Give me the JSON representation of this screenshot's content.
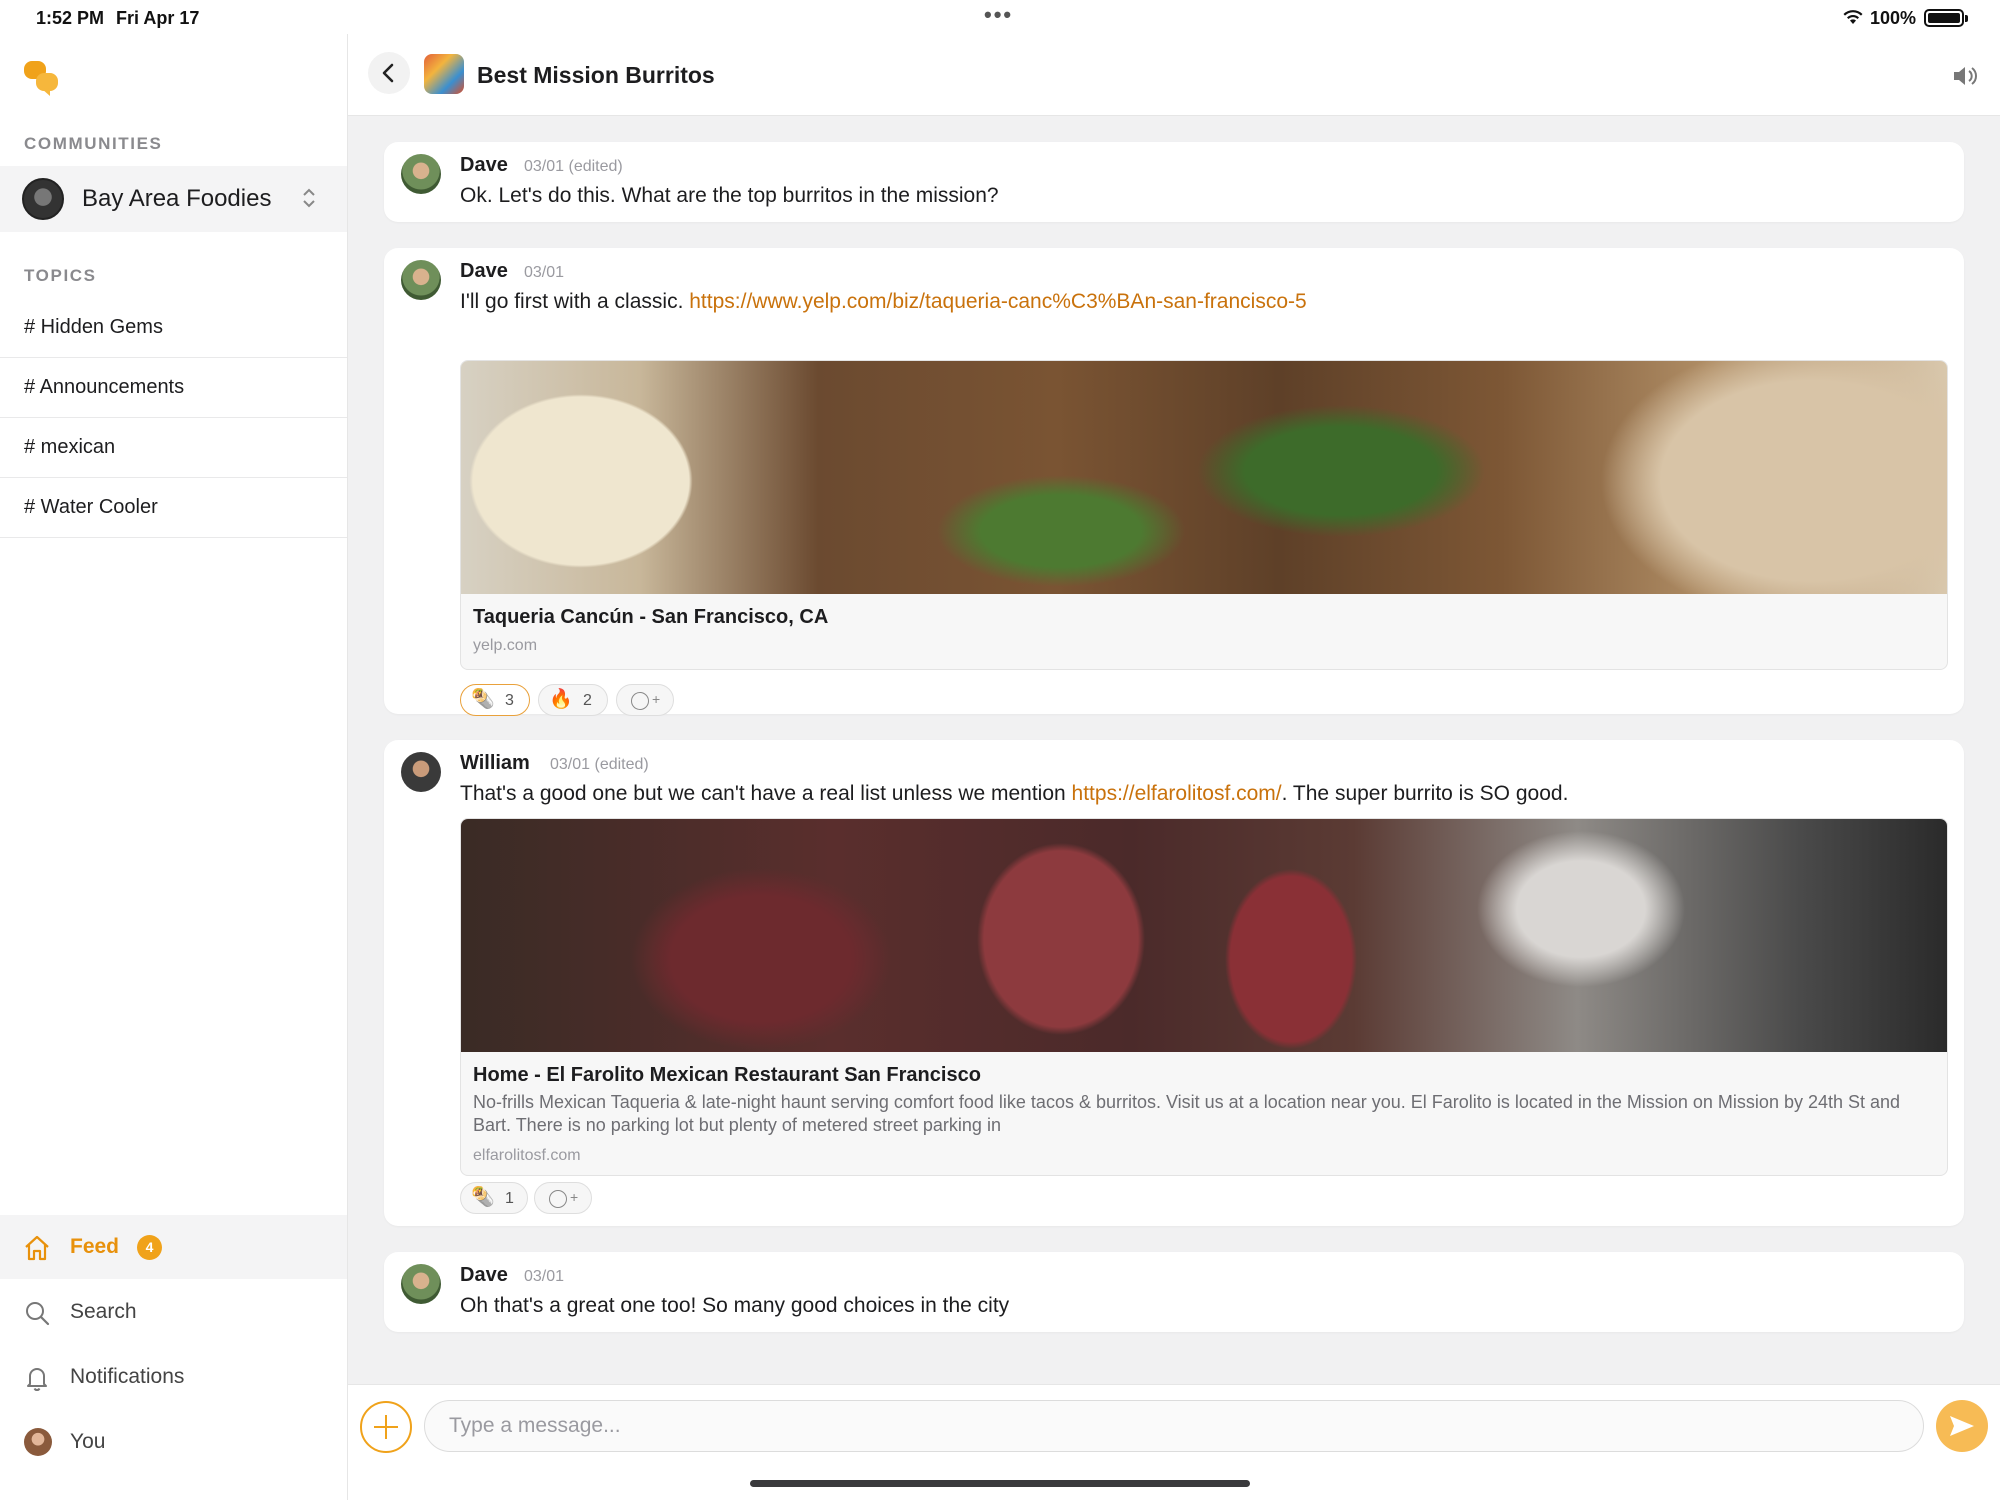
{
  "status_bar": {
    "time": "1:52 PM",
    "date": "Fri Apr 17",
    "battery": "100%"
  },
  "sidebar": {
    "communities_label": "COMMUNITIES",
    "community_name": "Bay Area Foodies",
    "topics_label": "TOPICS",
    "topics": [
      "# Hidden Gems",
      "# Announcements",
      "# mexican",
      "# Water Cooler"
    ],
    "nav": {
      "feed": "Feed",
      "feed_badge": "4",
      "search": "Search",
      "notifications": "Notifications",
      "you": "You"
    }
  },
  "thread": {
    "title": "Best Mission Burritos"
  },
  "messages": [
    {
      "author": "Dave",
      "meta": "03/01 (edited)",
      "text": "Ok. Let's do this. What are the top burritos in the mission?"
    },
    {
      "author": "Dave",
      "meta": "03/01",
      "text_before": "I'll go first with a classic. ",
      "link": "https://www.yelp.com/biz/taqueria-canc%C3%BAn-san-francisco-5",
      "preview": {
        "title": "Taqueria Cancún - San Francisco, CA",
        "domain": "yelp.com"
      },
      "reactions": [
        {
          "emoji": "🌯",
          "count": "3"
        },
        {
          "emoji": "🔥",
          "count": "2"
        }
      ]
    },
    {
      "author": "William",
      "meta": "03/01 (edited)",
      "text_before": "That's a good one but we can't have a real list unless we mention ",
      "link": "https://elfarolitosf.com/",
      "text_after": ". The super burrito is SO good.",
      "preview": {
        "title": "Home - El Farolito Mexican Restaurant San Francisco",
        "description": "No-frills Mexican Taqueria & late-night haunt serving comfort food like tacos & burritos. Visit us at a location near you. El Farolito is located in the Mission on Mission by 24th St and Bart. There is no parking lot but plenty of metered street parking in",
        "domain": "elfarolitosf.com"
      },
      "reactions": [
        {
          "emoji": "🌯",
          "count": "1"
        }
      ]
    },
    {
      "author": "Dave",
      "meta": "03/01",
      "text": "Oh that's a great one too! So many good choices in the city"
    }
  ],
  "composer": {
    "placeholder": "Type a message..."
  },
  "icons": [
    "app-logo-icon",
    "back-icon",
    "speaker-icon",
    "home-icon",
    "search-icon",
    "bell-icon",
    "plus-icon",
    "send-icon",
    "add-reaction-icon",
    "wifi-icon",
    "battery-icon"
  ],
  "colors": {
    "accent": "#f0a21a",
    "link": "#c9720c"
  }
}
